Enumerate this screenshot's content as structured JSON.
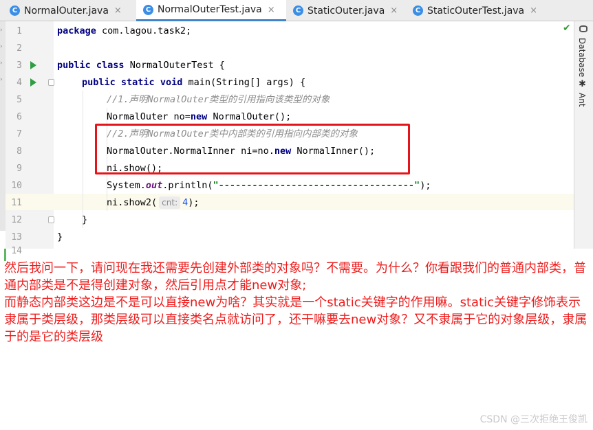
{
  "tabs": [
    {
      "label": "NormalOuter.java",
      "icon": "class-icon",
      "active": false
    },
    {
      "label": "NormalOuterTest.java",
      "icon": "class-icon",
      "active": true
    },
    {
      "label": "StaticOuter.java",
      "icon": "class-icon",
      "active": false
    },
    {
      "label": "StaticOuterTest.java",
      "icon": "class-icon",
      "active": false
    }
  ],
  "tab_icon_letter": "C",
  "close_glyph": "×",
  "line_numbers": [
    "1",
    "2",
    "3",
    "4",
    "5",
    "6",
    "7",
    "8",
    "9",
    "10",
    "11",
    "12",
    "13",
    "14"
  ],
  "code": {
    "l1_kw": "package",
    "l1_rest": " com.lagou.task2;",
    "l3_kw1": "public",
    "l3_kw2": "class",
    "l3_rest": " NormalOuterTest {",
    "l4_kw1": "public",
    "l4_kw2": "static",
    "l4_kw3": "void",
    "l4_rest": " main(String[] args) {",
    "l5_comment": "//1.声明NormalOuter类型的引用指向该类型的对象",
    "l6_a": "NormalOuter no=",
    "l6_kw": "new",
    "l6_b": " NormalOuter();",
    "l7_comment": "//2.声明NormalOuter类中内部类的引用指向内部类的对象",
    "l8_a": "NormalOuter.NormalInner ni=no.",
    "l8_kw": "new",
    "l8_b": " NormalInner();",
    "l9": "ni.show();",
    "l10_a": "System.",
    "l10_field": "out",
    "l10_b": ".println(",
    "l10_str": "\"-----------------------------------\"",
    "l10_c": ");",
    "l11_a": "ni.show2(",
    "l11_hint": "cnt:",
    "l11_num": "4",
    "l11_b": ");",
    "l12": "}",
    "l13": "}"
  },
  "side_panel": {
    "database_label": "Database",
    "ant_label": "Ant"
  },
  "annotation": {
    "p1": "然后我问一下，请问现在我还需要先创建外部类的对象吗？不需要。为什么？你看跟我们的普通内部类，普通内部类是不是得创建对象，然后引用点才能new对象;",
    "p2": "而静态内部类这边是不是可以直接new为啥？其实就是一个static关键字的作用嘛。static关键字修饰表示隶属于类层级，那类层级可以直接类名点就访问了，还干嘛要去new对象？又不隶属于它的对象层级，隶属于的是它的类层级"
  },
  "watermark": "CSDN @三次拒绝王俊凯",
  "colors": {
    "keyword": "#000080",
    "comment": "#8c8c8c",
    "string": "#067d17",
    "annotation_text": "#ee1c1c",
    "highlight_box": "#e5141a",
    "run_gutter": "#2f9e43"
  }
}
